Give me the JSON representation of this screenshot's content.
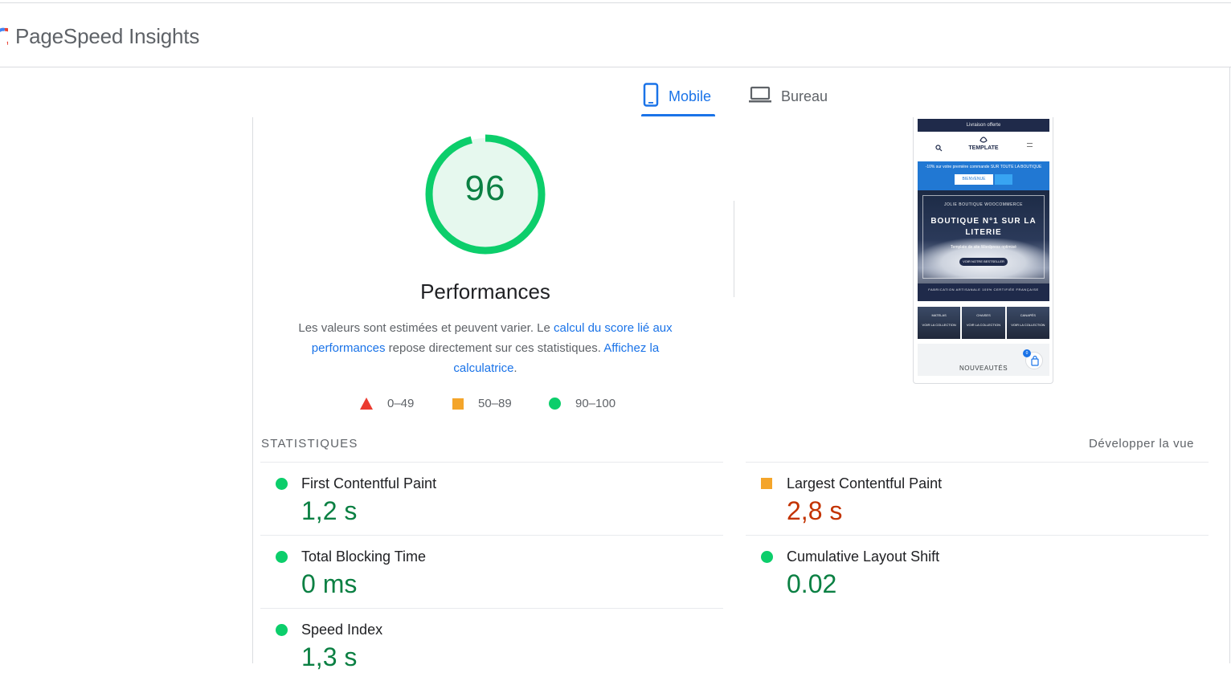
{
  "app": {
    "title": "PageSpeed Insights"
  },
  "tabs": [
    {
      "label": "Mobile",
      "icon": "phone-icon",
      "active": true
    },
    {
      "label": "Bureau",
      "icon": "laptop-icon",
      "active": false
    }
  ],
  "score": {
    "value": "96",
    "fraction": 0.96,
    "title": "Performances"
  },
  "description": {
    "text1": "Les valeurs sont estimées et peuvent varier. Le ",
    "link1": "calcul du score lié aux performances",
    "text2": " repose directement sur ces statistiques. ",
    "link2": "Affichez la calculatrice",
    "text3": "."
  },
  "legend": [
    {
      "shape": "triangle",
      "label": "0–49",
      "color": "#eb3b30"
    },
    {
      "shape": "square",
      "label": "50–89",
      "color": "#f4a52a"
    },
    {
      "shape": "circle",
      "label": "90–100",
      "color": "#0cce6b"
    }
  ],
  "stats": {
    "heading": "STATISTIQUES",
    "expand_label": "Développer la vue",
    "metrics": [
      {
        "name": "First Contentful Paint",
        "value": "1,2 s",
        "rating": "good"
      },
      {
        "name": "Largest Contentful Paint",
        "value": "2,8 s",
        "rating": "average"
      },
      {
        "name": "Total Blocking Time",
        "value": "0 ms",
        "rating": "good"
      },
      {
        "name": "Cumulative Layout Shift",
        "value": "0.02",
        "rating": "good"
      },
      {
        "name": "Speed Index",
        "value": "1,3 s",
        "rating": "good"
      }
    ]
  },
  "screenshot": {
    "topbar": "Livraison offerte",
    "logo": "TEMPLATE",
    "promo": "-10% sur votre première commande SUR TOUTE LA BOUTIQUE",
    "promo_button": "BIENVENUE",
    "hero_small": "JOLIE BOUTIQUE WOOCOMMERCE",
    "hero_title": "BOUTIQUE N°1 SUR LA LITERIE",
    "hero_sub": "Template de site Wordpress optimisé",
    "hero_button": "VOIR NOTRE BESTSELLER",
    "hero_footer": "FABRICATION ARTISANALE 100% CERTIFIÉE FRANÇAISE",
    "categories": [
      {
        "name": "MATELAS",
        "cta": "VOIR LA COLLECTION"
      },
      {
        "name": "CHAISES",
        "cta": "VOIR LA COLLECTION"
      },
      {
        "name": "CANAPÉS",
        "cta": "VOIR LA COLLECTION"
      }
    ],
    "new_label": "NOUVEAUTÉS",
    "cart_count": "0"
  },
  "colors": {
    "pass": "#0cce6b",
    "pass_text": "#0b8043",
    "average": "#f4a52a",
    "average_text": "#c33300",
    "fail": "#eb3b30",
    "accent": "#1a73e8"
  }
}
